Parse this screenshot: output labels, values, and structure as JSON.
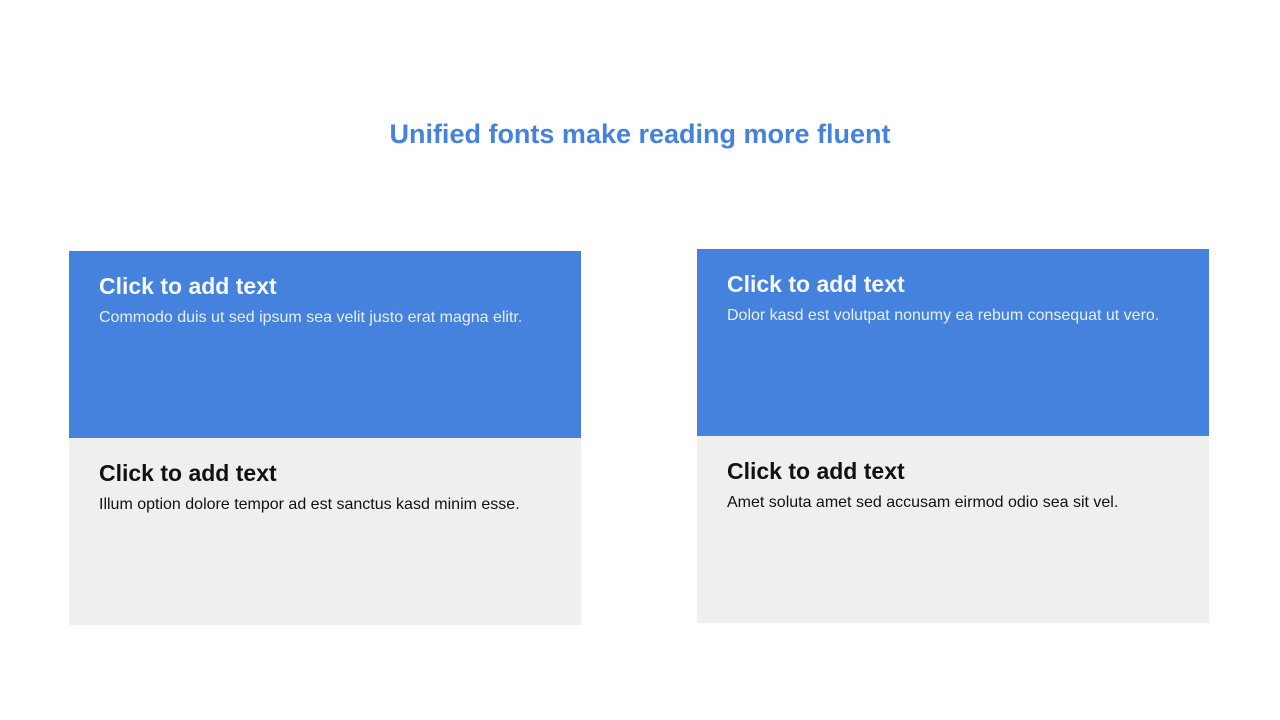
{
  "title": "Unified fonts make reading more fluent",
  "colors": {
    "accent": "#4582dd",
    "panel_light": "#efefef"
  },
  "cards": [
    {
      "top": {
        "heading": "Click to add text",
        "body": "Commodo duis ut sed ipsum sea velit justo erat magna elitr."
      },
      "bottom": {
        "heading": "Click to add text",
        "body": "Illum option dolore tempor ad est sanctus kasd minim esse."
      }
    },
    {
      "top": {
        "heading": "Click to add text",
        "body": "Dolor kasd est volutpat nonumy ea rebum consequat ut vero."
      },
      "bottom": {
        "heading": "Click to add text",
        "body": "Amet soluta amet sed accusam eirmod odio sea sit vel."
      }
    }
  ]
}
